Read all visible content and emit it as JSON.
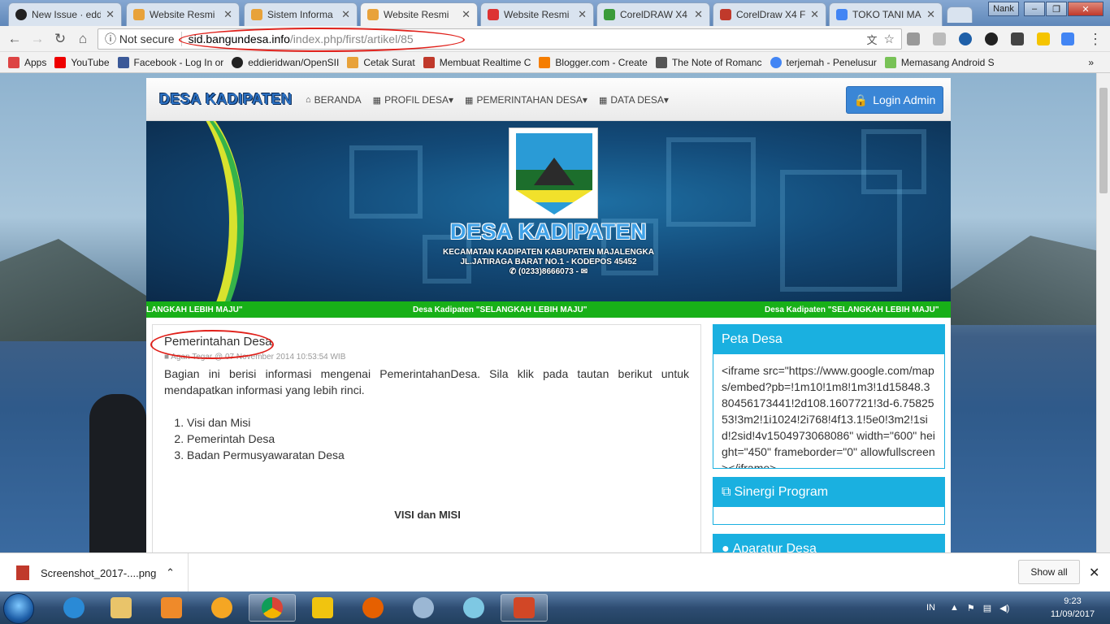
{
  "browser": {
    "tabs": [
      {
        "label": "New Issue · edd",
        "icon": "github-icon",
        "color": "#222222"
      },
      {
        "label": "Website Resmi",
        "icon": "sid-icon",
        "color": "#e8a23a"
      },
      {
        "label": "Sistem Informa",
        "icon": "sid-icon",
        "color": "#e8a23a"
      },
      {
        "label": "Website Resmi",
        "icon": "sid-icon",
        "color": "#e8a23a"
      },
      {
        "label": "Website Resmi",
        "icon": "shield-favicon-icon",
        "color": "#d33"
      },
      {
        "label": "CorelDRAW X4",
        "icon": "corel-icon",
        "color": "#3a9b3a"
      },
      {
        "label": "CorelDraw X4 F",
        "icon": "blog-icon",
        "color": "#c0392b"
      },
      {
        "label": "TOKO TANI MA",
        "icon": "maps-icon",
        "color": "#4285f4"
      }
    ],
    "window_user": "Nank",
    "address": {
      "security_label": "Not secure",
      "host": "sid.bangundesa.info",
      "path": "/index.php/first/artikel/85"
    },
    "bookmarks": [
      {
        "label": "Apps",
        "color": "#d44"
      },
      {
        "label": "YouTube",
        "color": "#e00"
      },
      {
        "label": "Facebook - Log In or",
        "color": "#3b5998"
      },
      {
        "label": "eddieridwan/OpenSII",
        "color": "#222"
      },
      {
        "label": "Cetak Surat",
        "color": "#e8a23a"
      },
      {
        "label": "Membuat Realtime C",
        "color": "#c0392b"
      },
      {
        "label": "Blogger.com - Create",
        "color": "#f57d00"
      },
      {
        "label": "The Note of Romanc",
        "color": "#555"
      },
      {
        "label": "terjemah - Penelusur",
        "color": "#4285f4"
      },
      {
        "label": "Memasang Android S",
        "color": "#78c257"
      }
    ],
    "bookmarks_more": "»"
  },
  "site": {
    "brand": "DESA KADIPATEN",
    "menu": [
      {
        "label": "BERANDA",
        "icon": "home-icon"
      },
      {
        "label": "PROFIL DESA",
        "icon": "grid-icon"
      },
      {
        "label": "PEMERINTAHAN DESA",
        "icon": "grid-icon"
      },
      {
        "label": "DATA DESA",
        "icon": "grid-icon"
      }
    ],
    "login_label": "Login Admin",
    "banner": {
      "title": "DESA KADIPATEN",
      "line1": "KECAMATAN KADIPATEN KABUPATEN MAJALENGKA",
      "line2": "JL.JATIRAGA BARAT NO.1 - KODEPOS 45452",
      "phone": "(0233)8666073 -"
    },
    "ticker": [
      "LANGKAH LEBIH MAJU\"",
      "Desa Kadipaten \"SELANGKAH LEBIH MAJU\"",
      "Desa Kadipaten \"SELANGKAH LEBIH MAJU\""
    ],
    "article": {
      "title": "Pemerintahan Desa",
      "meta": "Agan Tegar @ 07 November 2014 10:53:54 WIB",
      "intro": "Bagian ini berisi informasi mengenai PemerintahanDesa. Sila klik pada tautan berikut untuk mendapatkan informasi yang lebih rinci.",
      "links": [
        "Visi dan Misi",
        "Pemerintah Desa",
        "Badan Permusyawaratan Desa"
      ],
      "subhead": "VISI dan MISI"
    },
    "sidebar": {
      "peta_title": "Peta Desa",
      "peta_code": "<iframe src=\"https://www.google.com/maps/embed?pb=!1m10!1m8!1m3!1d15848.380456173441!2d108.1607721!3d-6.7582553!3m2!1i1024!2i768!4f13.1!5e0!3m2!1sid!2sid!4v1504973068086\" width=\"600\" height=\"450\" frameborder=\"0\" allowfullscreen></iframe>",
      "sinergi_title": "Sinergi Program",
      "aparatur_title": "Aparatur Desa"
    }
  },
  "downloads": {
    "file": "Screenshot_2017-....png",
    "show_all": "Show all"
  },
  "taskbar": {
    "lang": "IN",
    "time": "9:23",
    "date": "11/09/2017"
  }
}
